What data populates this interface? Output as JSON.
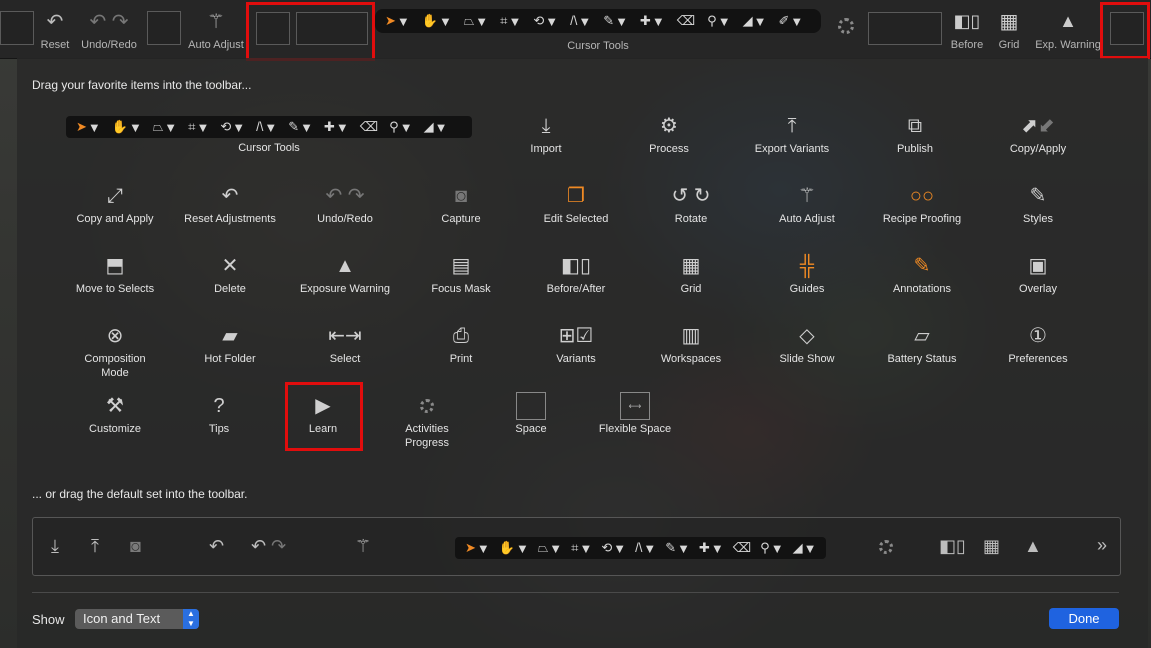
{
  "top_toolbar": {
    "reset": {
      "label": "Reset",
      "icon": "reset-arrow-icon"
    },
    "undo_redo": {
      "label": "Undo/Redo",
      "icon": "undo-redo-icon"
    },
    "auto_adjust": {
      "label": "Auto Adjust",
      "icon": "magic-wand-icon"
    },
    "cursor_tools": {
      "label": "Cursor Tools"
    },
    "before": {
      "label": "Before",
      "icon": "before-after-icon"
    },
    "grid": {
      "label": "Grid",
      "icon": "grid-icon"
    },
    "exp_warning": {
      "label": "Exp. Warning",
      "icon": "warning-triangle-icon"
    }
  },
  "panel": {
    "heading_favorites": "Drag your favorite items into the toolbar...",
    "heading_default": "... or drag the default set into the toolbar.",
    "items": [
      {
        "label": "Import",
        "icon": "import-icon"
      },
      {
        "label": "Process",
        "icon": "gear-icon"
      },
      {
        "label": "Export Variants",
        "icon": "export-icon"
      },
      {
        "label": "Publish",
        "icon": "publish-icon"
      },
      {
        "label": "Copy/Apply",
        "icon": "copy-apply-icon"
      },
      {
        "label": "Copy and Apply",
        "icon": "copy-and-apply-icon"
      },
      {
        "label": "Reset Adjustments",
        "icon": "reset-arrow-icon"
      },
      {
        "label": "Undo/Redo",
        "icon": "undo-redo-icon"
      },
      {
        "label": "Capture",
        "icon": "camera-icon"
      },
      {
        "label": "Edit Selected",
        "icon": "edit-selected-icon"
      },
      {
        "label": "Rotate",
        "icon": "rotate-icon"
      },
      {
        "label": "Auto Adjust",
        "icon": "magic-wand-icon"
      },
      {
        "label": "Recipe Proofing",
        "icon": "glasses-icon"
      },
      {
        "label": "Styles",
        "icon": "brush-icon"
      },
      {
        "label": "Move to Selects",
        "icon": "move-to-selects-icon"
      },
      {
        "label": "Delete",
        "icon": "x-icon"
      },
      {
        "label": "Exposure Warning",
        "icon": "warning-triangle-icon"
      },
      {
        "label": "Focus Mask",
        "icon": "focus-mask-icon"
      },
      {
        "label": "Before/After",
        "icon": "before-after-icon"
      },
      {
        "label": "Grid",
        "icon": "grid-icon"
      },
      {
        "label": "Guides",
        "icon": "guides-icon"
      },
      {
        "label": "Annotations",
        "icon": "annotation-icon"
      },
      {
        "label": "Overlay",
        "icon": "overlay-icon"
      },
      {
        "label": "Composition Mode",
        "icon": "composition-mode-icon"
      },
      {
        "label": "Hot Folder",
        "icon": "hot-folder-icon"
      },
      {
        "label": "Select",
        "icon": "select-icon"
      },
      {
        "label": "Print",
        "icon": "printer-icon"
      },
      {
        "label": "Variants",
        "icon": "variants-icon"
      },
      {
        "label": "Workspaces",
        "icon": "workspaces-icon"
      },
      {
        "label": "Slide Show",
        "icon": "slideshow-icon"
      },
      {
        "label": "Battery Status",
        "icon": "battery-icon"
      },
      {
        "label": "Preferences",
        "icon": "preferences-icon"
      },
      {
        "label": "Customize",
        "icon": "tools-icon"
      },
      {
        "label": "Tips",
        "icon": "question-icon"
      },
      {
        "label": "Learn",
        "icon": "play-icon"
      },
      {
        "label": "Activities Progress",
        "icon": "spinner-icon"
      },
      {
        "label": "Space",
        "icon": "space-icon"
      },
      {
        "label": "Flexible Space",
        "icon": "flexible-space-icon"
      }
    ],
    "cursor_tools_label": "Cursor Tools",
    "overflow": "»"
  },
  "footer": {
    "show_label": "Show",
    "show_value": "Icon and Text",
    "done_label": "Done"
  },
  "colors": {
    "accent_orange": "#f08a24",
    "highlight_red": "#e10d0d",
    "done_blue": "#1f63e0"
  }
}
